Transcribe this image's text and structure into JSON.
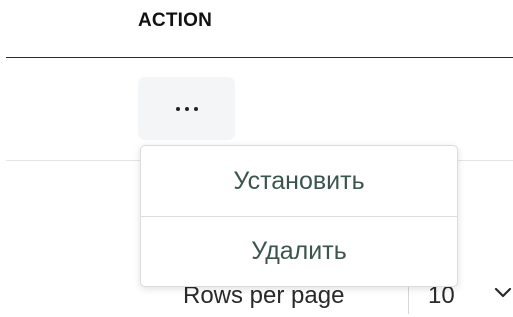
{
  "table": {
    "action_header": "ACTION",
    "action_button_icon": "more-horizontal-icon"
  },
  "menu": {
    "items": [
      {
        "label": "Установить"
      },
      {
        "label": "Удалить"
      }
    ]
  },
  "pagination": {
    "rows_per_page_label": "Rows per page",
    "rows_per_page_value": "10",
    "dropdown_icon": "chevron-down-icon"
  }
}
